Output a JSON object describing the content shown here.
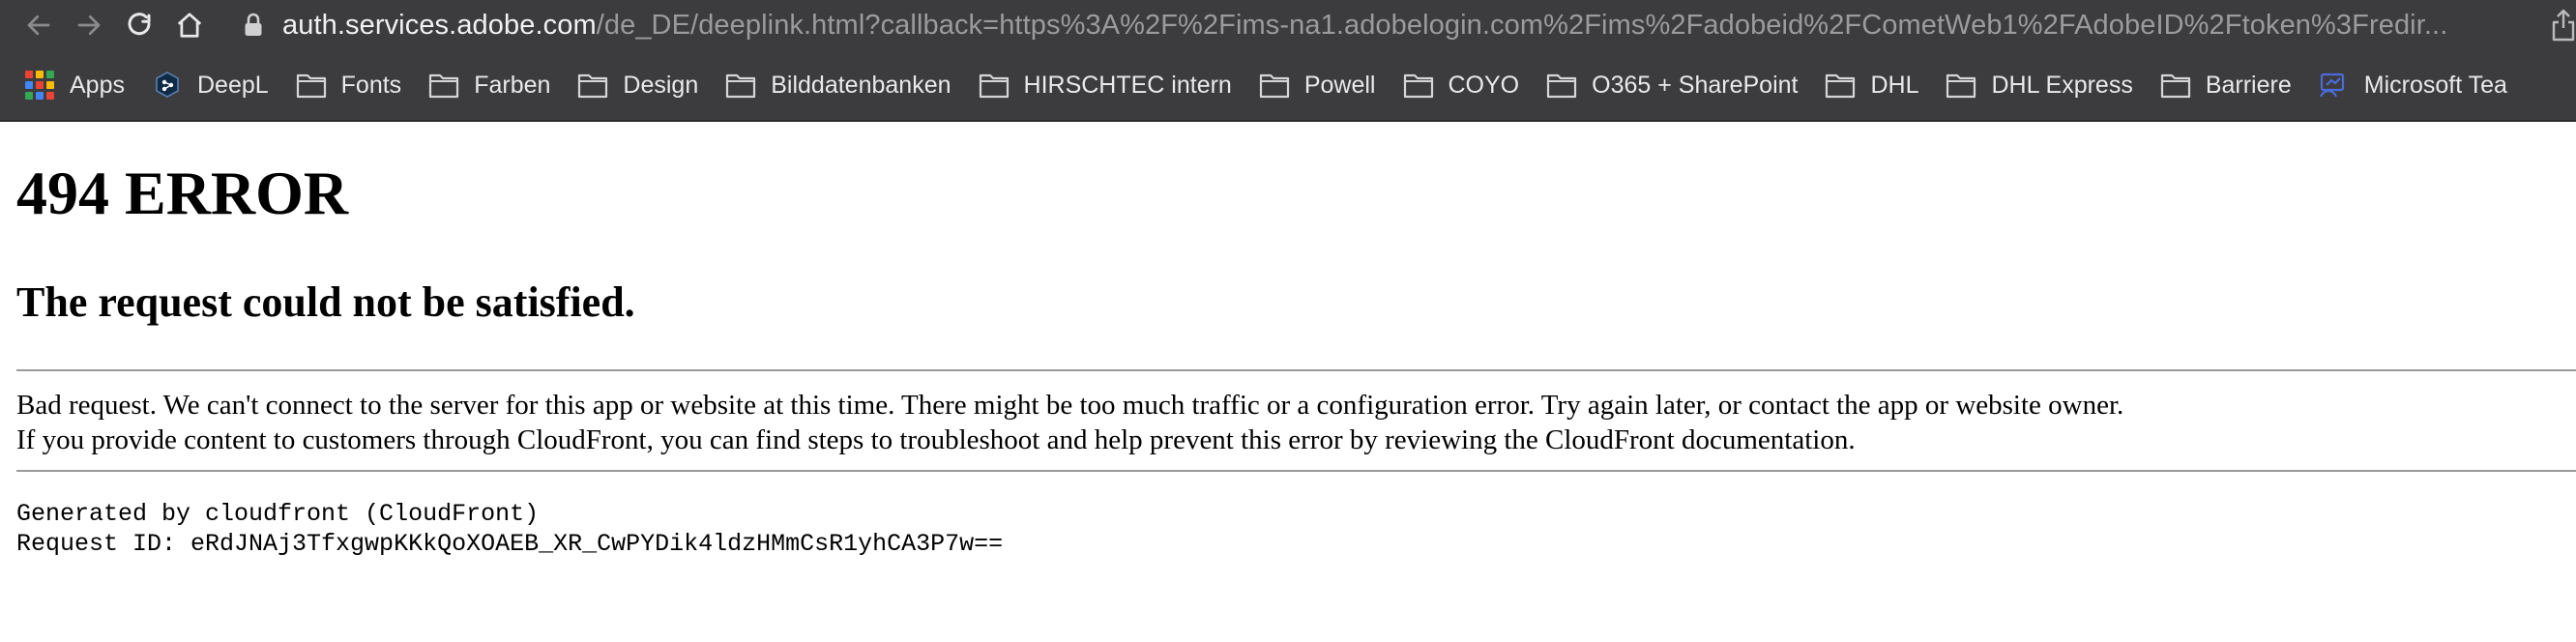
{
  "browser": {
    "url_host": "auth.services.adobe.com",
    "url_path": "/de_DE/deeplink.html?callback=https%3A%2F%2Fims-na1.adobelogin.com%2Fims%2Fadobeid%2FCometWeb1%2FAdobeID%2Ftoken%3Fredir...",
    "nav_icons": [
      "back-arrow-icon",
      "forward-arrow-icon",
      "reload-icon",
      "home-icon",
      "lock-icon",
      "share-icon"
    ]
  },
  "bookmarks": [
    {
      "label": "Apps",
      "icon": "apps-grid-icon"
    },
    {
      "label": "DeepL",
      "icon": "deepl-icon"
    },
    {
      "label": "Fonts",
      "icon": "folder-icon"
    },
    {
      "label": "Farben",
      "icon": "folder-icon"
    },
    {
      "label": "Design",
      "icon": "folder-icon"
    },
    {
      "label": "Bilddatenbanken",
      "icon": "folder-icon"
    },
    {
      "label": "HIRSCHTEC intern",
      "icon": "folder-icon"
    },
    {
      "label": "Powell",
      "icon": "folder-icon"
    },
    {
      "label": "COYO",
      "icon": "folder-icon"
    },
    {
      "label": "O365 + SharePoint",
      "icon": "folder-icon"
    },
    {
      "label": "DHL",
      "icon": "folder-icon"
    },
    {
      "label": "DHL Express",
      "icon": "folder-icon"
    },
    {
      "label": "Barriere",
      "icon": "folder-icon"
    },
    {
      "label": "Microsoft Tea",
      "icon": "microsoft-teams-icon"
    }
  ],
  "page": {
    "title": "494 ERROR",
    "subtitle": "The request could not be satisfied.",
    "message_line1": "Bad request. We can't connect to the server for this app or website at this time. There might be too much traffic or a configuration error. Try again later, or contact the app or website owner.",
    "message_line2": "If you provide content to customers through CloudFront, you can find steps to troubleshoot and help prevent this error by reviewing the CloudFront documentation.",
    "generated_by": "Generated by cloudfront (CloudFront)",
    "request_id": "Request ID: eRdJNAj3TfxgwpKKkQoXOAEB_XR_CwPYDik4ldzHMmCsR1yhCA3P7w=="
  },
  "colors": {
    "chrome_bg": "#3c3c3e",
    "folder_outline": "#d6d6d8",
    "deepl_blue": "#0f2b46",
    "teams_blue": "#4b6bd8"
  }
}
